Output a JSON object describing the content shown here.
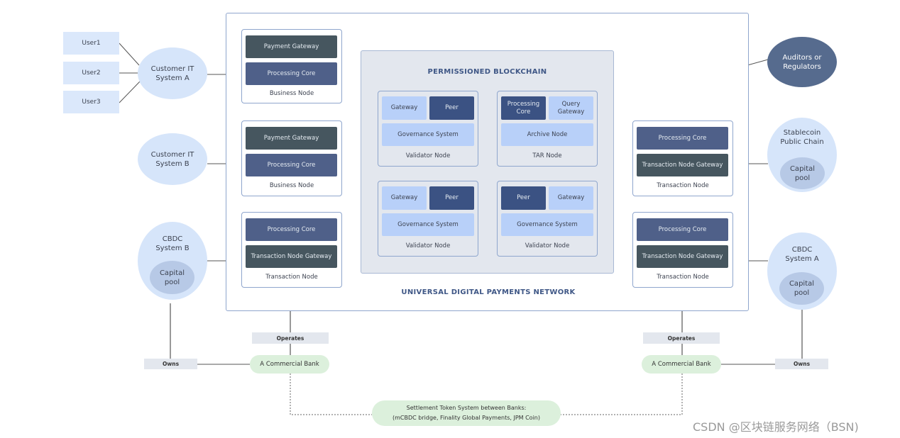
{
  "network": {
    "outer_title": "UNIVERSAL DIGITAL PAYMENTS NETWORK",
    "blockchain_title": "PERMISSIONED BLOCKCHAIN"
  },
  "users": [
    "User1",
    "User2",
    "User3"
  ],
  "customer_systems": [
    {
      "line1": "Customer IT",
      "line2": "System A"
    },
    {
      "line1": "Customer IT",
      "line2": "System B"
    }
  ],
  "cbdc_b": {
    "line1": "CBDC",
    "line2": "System B",
    "pool1": "Capital",
    "pool2": "pool"
  },
  "cbdc_a": {
    "line1": "CBDC",
    "line2": "System A",
    "pool1": "Capital",
    "pool2": "pool"
  },
  "stablecoin": {
    "line1": "Stablecoin",
    "line2": "Public Chain",
    "pool1": "Capital",
    "pool2": "pool"
  },
  "auditors": {
    "line1": "Auditors or",
    "line2": "Regulators"
  },
  "business_nodes": [
    {
      "top": "Payment Gateway",
      "bottom": "Processing Core",
      "label": "Business Node"
    },
    {
      "top": "Payment Gateway",
      "bottom": "Processing Core",
      "label": "Business Node"
    }
  ],
  "transaction_node_left": {
    "top": "Processing Core",
    "bottom": "Transaction Node Gateway",
    "label": "Transaction Node"
  },
  "transaction_nodes_right": [
    {
      "top": "Processing Core",
      "bottom": "Transaction Node Gateway",
      "label": "Transaction Node"
    },
    {
      "top": "Processing Core",
      "bottom": "Transaction Node Gateway",
      "label": "Transaction Node"
    }
  ],
  "validator_top": {
    "left": "Gateway",
    "right": "Peer",
    "bottom": "Governance System",
    "label": "Validator Node"
  },
  "tar_node": {
    "left1": "Processing",
    "left2": "Core",
    "right1": "Query",
    "right2": "Gateway",
    "bottom": "Archive Node",
    "label": "TAR Node"
  },
  "validator_bottom_left": {
    "left": "Gateway",
    "right": "Peer",
    "bottom": "Governance System",
    "label": "Validator Node"
  },
  "validator_bottom_right": {
    "left": "Peer",
    "right": "Gateway",
    "bottom": "Governance System",
    "label": "Validator Node"
  },
  "relations": {
    "operates": "Operates",
    "owns": "Owns",
    "bank": "A Commercial Bank"
  },
  "settlement": {
    "line1": "Settlement Token System between Banks:",
    "line2": "(mCBDC bridge, Finality Global Payments, JPM Coin)"
  },
  "watermark": "CSDN @区块链服务网络（BSN)"
}
